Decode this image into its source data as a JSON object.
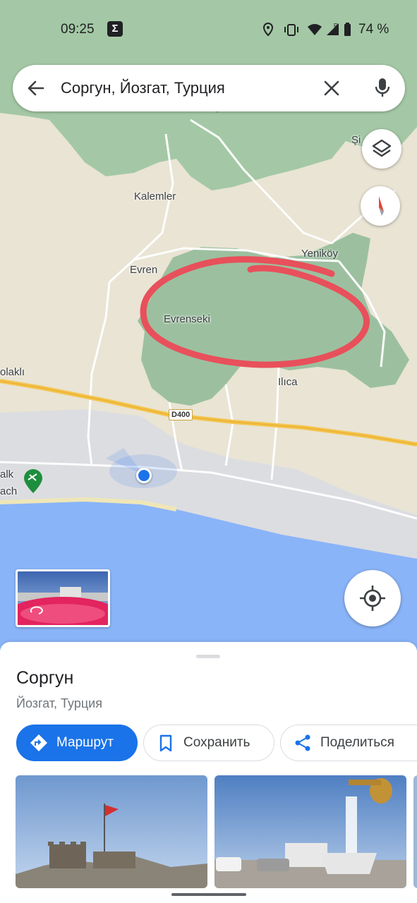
{
  "status_bar": {
    "time": "09:25",
    "sigma_badge": "Σ",
    "battery_text": "74 %",
    "icons": [
      "location-icon",
      "vibrate-icon",
      "wifi-icon",
      "signal-icon",
      "battery-icon"
    ]
  },
  "search": {
    "query": "Соргун, Йозгат, Турция"
  },
  "map": {
    "labels": {
      "kalemler": "Kalemler",
      "evren": "Evren",
      "evrenseki": "Evrenseki",
      "yenikoy": "Yeniköy",
      "ilica": "Ilıca",
      "olakli": "olaklı",
      "si": "Şi",
      "beach_1": "alk",
      "beach_2": "ach",
      "road": "D400"
    },
    "colors": {
      "land": "#e9e4d4",
      "forest": "#9cc09f",
      "water": "#8ab4f8",
      "beach": "#dcdde0",
      "highway": "#f4c44e",
      "annotation": "#e8505b",
      "location_dot": "#1a73e8"
    }
  },
  "place": {
    "title": "Соргун",
    "subtitle": "Йозгат, Турция"
  },
  "actions": {
    "route": "Маршрут",
    "save": "Сохранить",
    "share": "Поделиться"
  }
}
